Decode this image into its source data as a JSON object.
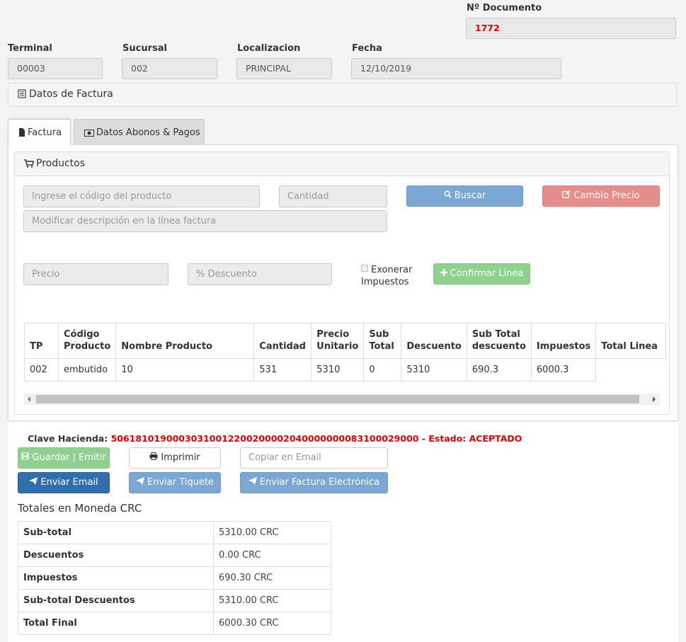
{
  "header": {
    "doc_label": "Nº Documento",
    "doc_value": "1772",
    "terminal_label": "Terminal",
    "terminal_value": "00003",
    "sucursal_label": "Sucursal",
    "sucursal_value": "002",
    "localizacion_label": "Localizacion",
    "localizacion_value": "PRINCIPAL",
    "fecha_label": "Fecha",
    "fecha_value": "12/10/2019"
  },
  "section_title": "Datos de Factura",
  "tabs": [
    {
      "label": "Factura",
      "icon": "file-icon",
      "active": true
    },
    {
      "label": "Datos Abonos & Pagos",
      "icon": "money-icon",
      "active": false
    }
  ],
  "productos": {
    "title": "Productos",
    "codigo_placeholder": "Ingrese el código del producto",
    "cantidad_placeholder": "Cantidad",
    "buscar_label": "Buscar",
    "cambio_precio_label": "Cambio Precio",
    "descripcion_placeholder": "Modificar descripción en la línea factura",
    "precio_placeholder": "Precio",
    "descuento_placeholder": "% Descuento",
    "exonerar_label": "Exonerar Impuestos",
    "confirmar_label": "Confirmar Línea"
  },
  "table": {
    "headers": [
      "TP",
      "Código Producto",
      "Nombre Producto",
      "Cantidad",
      "Precio Unitario",
      "Sub Total",
      "Descuento",
      "Sub Total descuento",
      "Impuestos",
      "Total Linea"
    ],
    "rows": [
      [
        "002",
        "embutido",
        "10",
        "531",
        "5310",
        "0",
        "5310",
        "690.3",
        "6000.3"
      ]
    ]
  },
  "clave": {
    "label": "Clave Hacienda:",
    "value": "50618101900030310012200200002040000000083100029000 - Estado: ACEPTADO"
  },
  "actions": {
    "guardar": "Guardar | Emitir",
    "imprimir": "Imprimir",
    "copiar_placeholder": "Copiar en Email",
    "enviar_email": "Enviar Email",
    "enviar_tiquete": "Enviar Tiquete",
    "enviar_factura": "Enviar Factura Electrónica"
  },
  "totales": {
    "title": "Totales en Moneda CRC",
    "rows": [
      {
        "label": "Sub-total",
        "value": "5310.00 CRC"
      },
      {
        "label": "Descuentos",
        "value": "0.00 CRC"
      },
      {
        "label": "Impuestos",
        "value": "690.30 CRC"
      },
      {
        "label": "Sub-total Descuentos",
        "value": "5310.00 CRC"
      },
      {
        "label": "Total Final",
        "value": "6000.30 CRC"
      }
    ]
  },
  "colors": {
    "danger_text": "#e00000",
    "buscar": "#7aa7d4",
    "cambio_precio": "#e58d8a",
    "confirmar": "#8fd18f",
    "guardar": "#8fd18f",
    "enviar_email": "#2f6faf",
    "enviar_light": "#7aa7d4"
  }
}
